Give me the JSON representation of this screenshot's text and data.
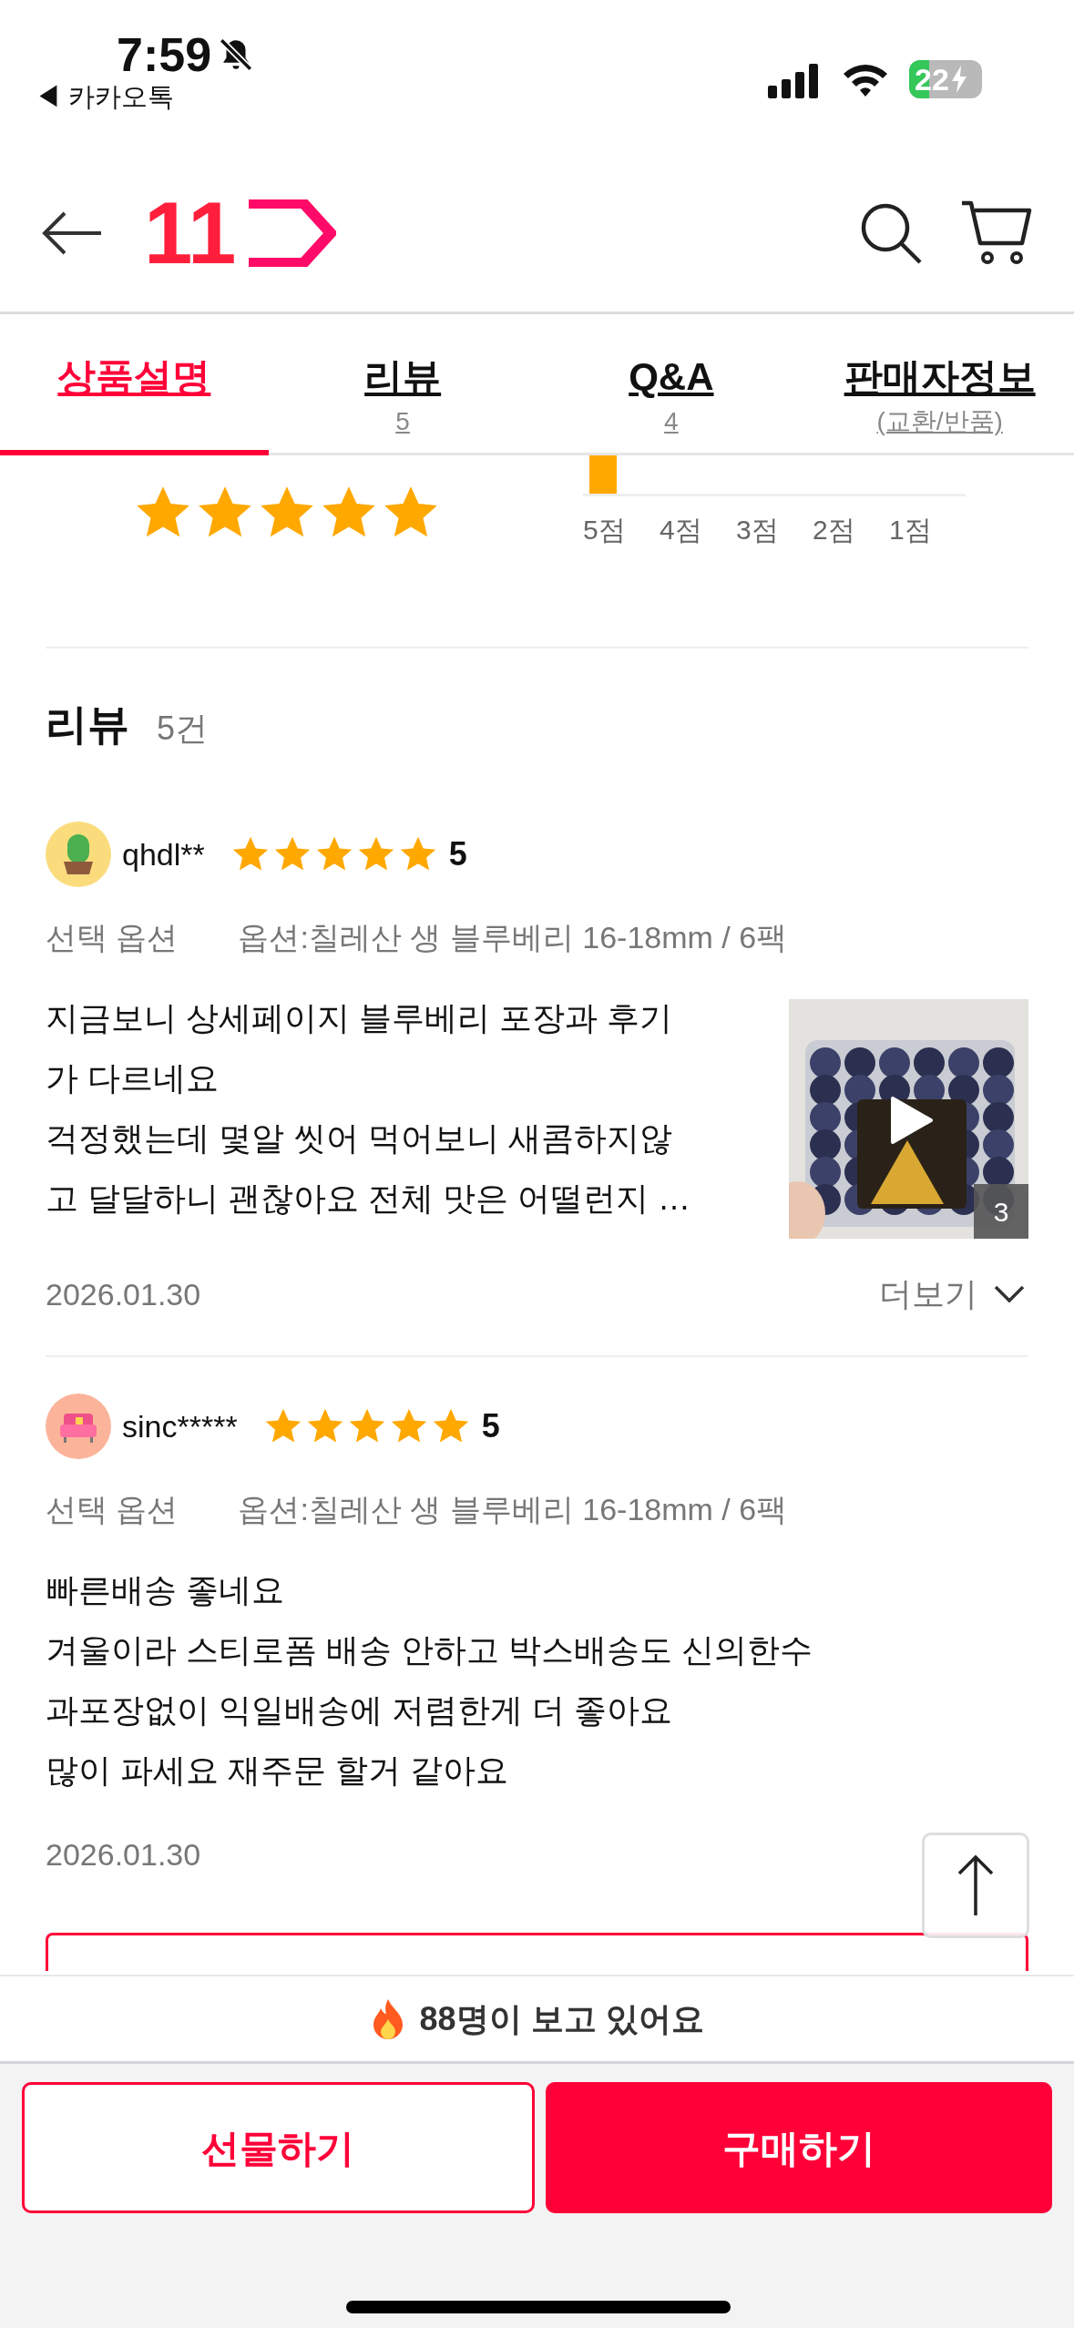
{
  "status_bar": {
    "time": "7:59",
    "back_app": "◀ 카카오톡",
    "battery": "22"
  },
  "header": {
    "logo": "11"
  },
  "tabs": [
    {
      "label": "상품설명",
      "selected": true
    },
    {
      "label": "리뷰",
      "sub": "5",
      "selected": false
    },
    {
      "label": "Q&A",
      "sub": "4",
      "selected": false
    },
    {
      "label": "판매자정보",
      "sub": "(교환/반품)",
      "selected": false
    }
  ],
  "rating_summary": {
    "stars": 5,
    "distribution": [
      {
        "label": "5점"
      },
      {
        "label": "4점"
      },
      {
        "label": "3점"
      },
      {
        "label": "2점"
      },
      {
        "label": "1점"
      }
    ]
  },
  "reviews_header": {
    "title": "리뷰",
    "count": "5건"
  },
  "reviews": [
    {
      "avatar": {
        "kind": "cactus"
      },
      "user": "qhdl**",
      "stars": 5,
      "score": "5",
      "option_label": "선택 옵션",
      "option": "옵션:칠레산 생 블루베리 16-18mm / 6팩",
      "lines": [
        "지금보니 상세페이지 블루베리 포장과 후기",
        "가 다르네요",
        "걱정했는데 몇알 씻어 먹어보니 새콤하지않",
        "고 달달하니 괜찮아요 전체 맛은 어떨런지 …"
      ],
      "media": {
        "kind": "picture",
        "count": "3"
      },
      "date": "2026.01.30",
      "more": "더보기"
    },
    {
      "avatar": {
        "kind": "sofa"
      },
      "user": "sinc*****",
      "stars": 5,
      "score": "5",
      "option_label": "선택 옵션",
      "option": "옵션:칠레산 생 블루베리 16-18mm / 6팩",
      "lines": [
        "빠른배송 좋네요",
        "겨울이라 스티로폼 배송 안하고 박스배송도 신의한수",
        "과포장없이 익일배송에 저렴한게 더 좋아요",
        "많이 파세요 재주문 할거 같아요"
      ],
      "date": "2026.01.30"
    }
  ],
  "viewing_banner": "88명이 보고 있어요",
  "actions": [
    {
      "label": "선물하기",
      "kind": "outline"
    },
    {
      "label": "구매하기",
      "kind": "filled"
    }
  ]
}
